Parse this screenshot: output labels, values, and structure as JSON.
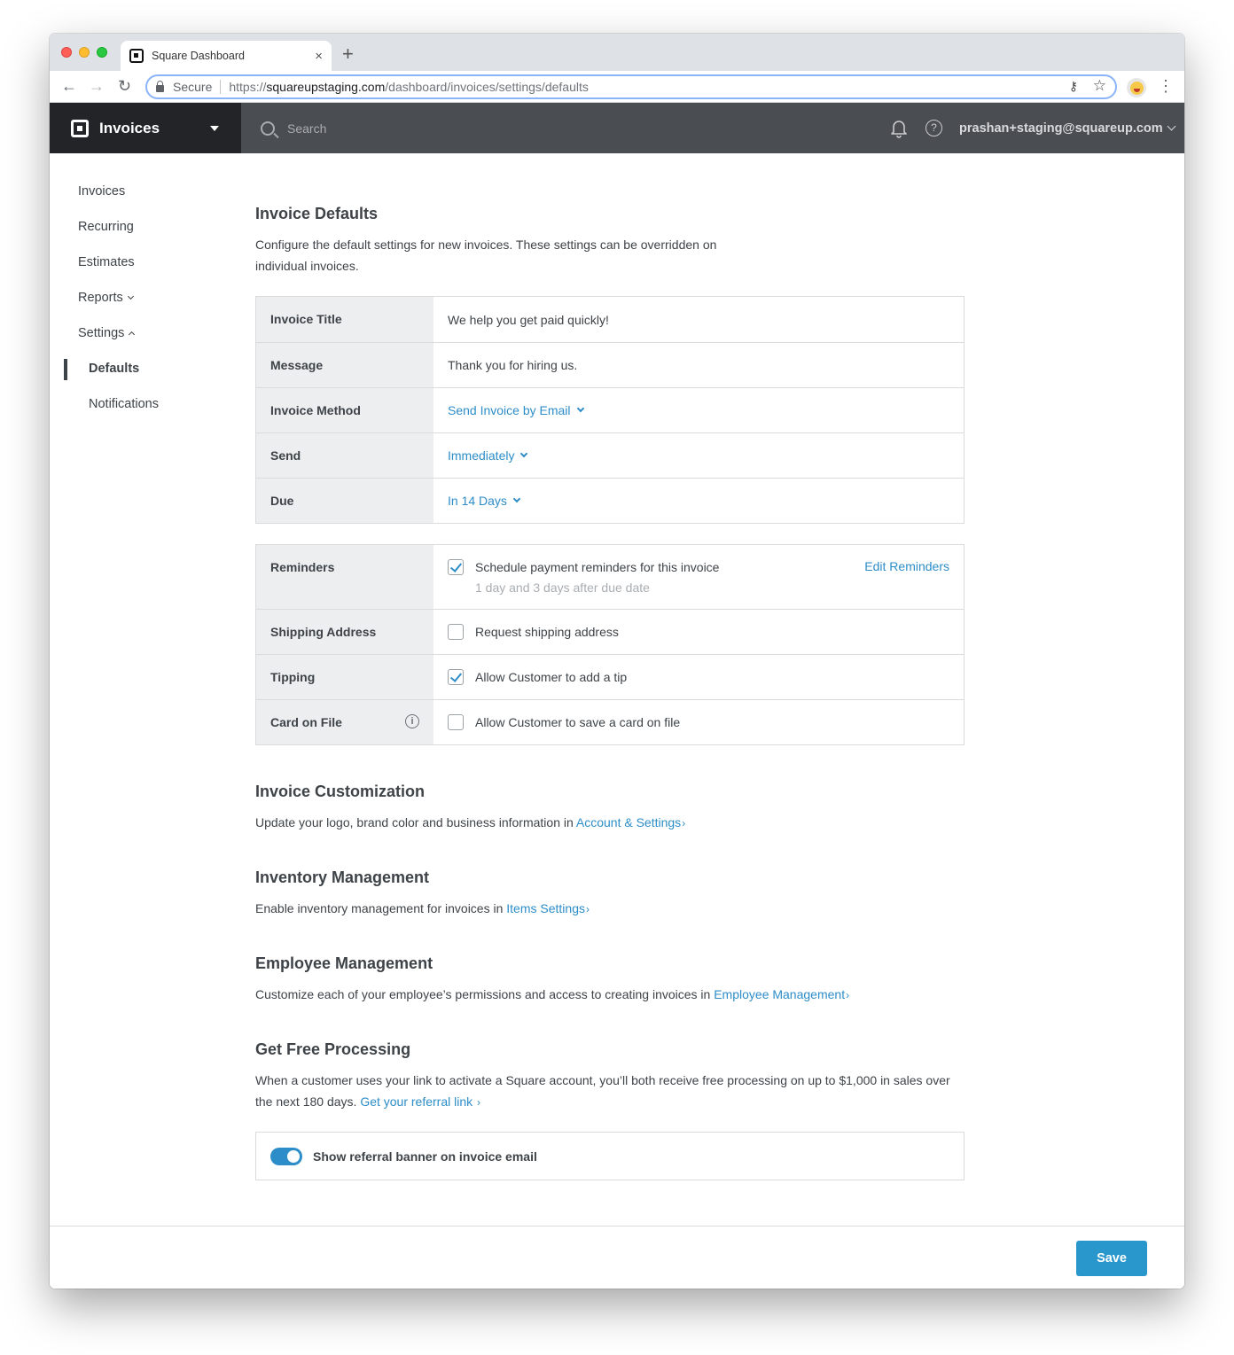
{
  "browser": {
    "tab_title": "Square Dashboard",
    "tab_close": "×",
    "new_tab": "+",
    "secure_label": "Secure",
    "url_scheme": "https://",
    "url_host": "squareupstaging.com",
    "url_path": "/dashboard/invoices/settings/defaults",
    "back": "←",
    "forward": "→",
    "reload": "↻",
    "key_icon": "⚷",
    "star_icon": "☆",
    "menu_icon": "⋮"
  },
  "appbar": {
    "app_name": "Invoices",
    "search_placeholder": "Search",
    "help_glyph": "?",
    "account": "prashan+staging@squareup.com"
  },
  "sidebar": {
    "items": [
      {
        "label": "Invoices"
      },
      {
        "label": "Recurring"
      },
      {
        "label": "Estimates"
      },
      {
        "label": "Reports"
      },
      {
        "label": "Settings"
      },
      {
        "label": "Defaults",
        "active": true
      },
      {
        "label": "Notifications"
      }
    ]
  },
  "defaults": {
    "title": "Invoice Defaults",
    "description": "Configure the default settings for new invoices. These settings can be overridden on individual invoices.",
    "rows": [
      {
        "label": "Invoice Title",
        "value": "We help you get paid quickly!"
      },
      {
        "label": "Message",
        "value": "Thank you for hiring us."
      },
      {
        "label": "Invoice Method",
        "value": "Send Invoice by Email"
      },
      {
        "label": "Send",
        "value": "Immediately"
      },
      {
        "label": "Due",
        "value": "In 14 Days"
      }
    ]
  },
  "options": {
    "reminders": {
      "label": "Reminders",
      "checkbox_label": "Schedule payment reminders for this invoice",
      "checked": true,
      "hint": "1 day and 3 days after due date",
      "edit_link": "Edit Reminders"
    },
    "shipping": {
      "label": "Shipping Address",
      "checkbox_label": "Request shipping address",
      "checked": false
    },
    "tipping": {
      "label": "Tipping",
      "checkbox_label": "Allow Customer to add a tip",
      "checked": true
    },
    "card_on_file": {
      "label": "Card on File",
      "info_glyph": "i",
      "checkbox_label": "Allow Customer to save a card on file",
      "checked": false
    }
  },
  "customization": {
    "title": "Invoice Customization",
    "text": "Update your logo, brand color and business information in ",
    "link": "Account & Settings"
  },
  "inventory": {
    "title": "Inventory Management",
    "text": "Enable inventory management for invoices in ",
    "link": "Items Settings"
  },
  "employee": {
    "title": "Employee Management",
    "text": "Customize each of your employee’s permissions and access to creating invoices in ",
    "link": "Employee Management"
  },
  "processing": {
    "title": "Get Free Processing",
    "text": "When a customer uses your link to activate a Square account, you’ll both receive free processing on up to $1,000 in sales over the next 180 days. ",
    "link": "Get your referral link",
    "toggle_label": "Show referral banner on invoice email",
    "toggle_on": true
  },
  "link_arrow": "›",
  "footer": {
    "save_label": "Save"
  },
  "colors": {
    "accent": "#2d8dc8",
    "button": "#2996cc",
    "header": "#4a4d51",
    "switcher": "#222428"
  }
}
